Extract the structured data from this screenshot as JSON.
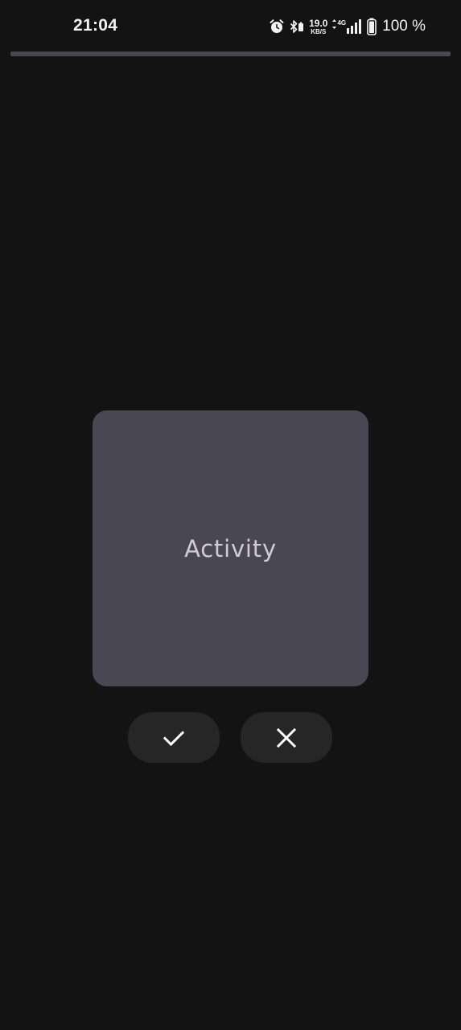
{
  "status_bar": {
    "time": "21:04",
    "net_speed_value": "19.0",
    "net_speed_unit": "KB/S",
    "network_type": "4G",
    "battery_percent": "100 %"
  },
  "progress": {
    "fraction": 0
  },
  "card": {
    "label": "Activity"
  },
  "actions": {
    "confirm_icon": "check-icon",
    "cancel_icon": "close-icon"
  },
  "colors": {
    "background": "#131313",
    "card": "#4a4754",
    "card_text": "#d0cbd8",
    "button": "#262626",
    "icon": "#ffffff"
  }
}
